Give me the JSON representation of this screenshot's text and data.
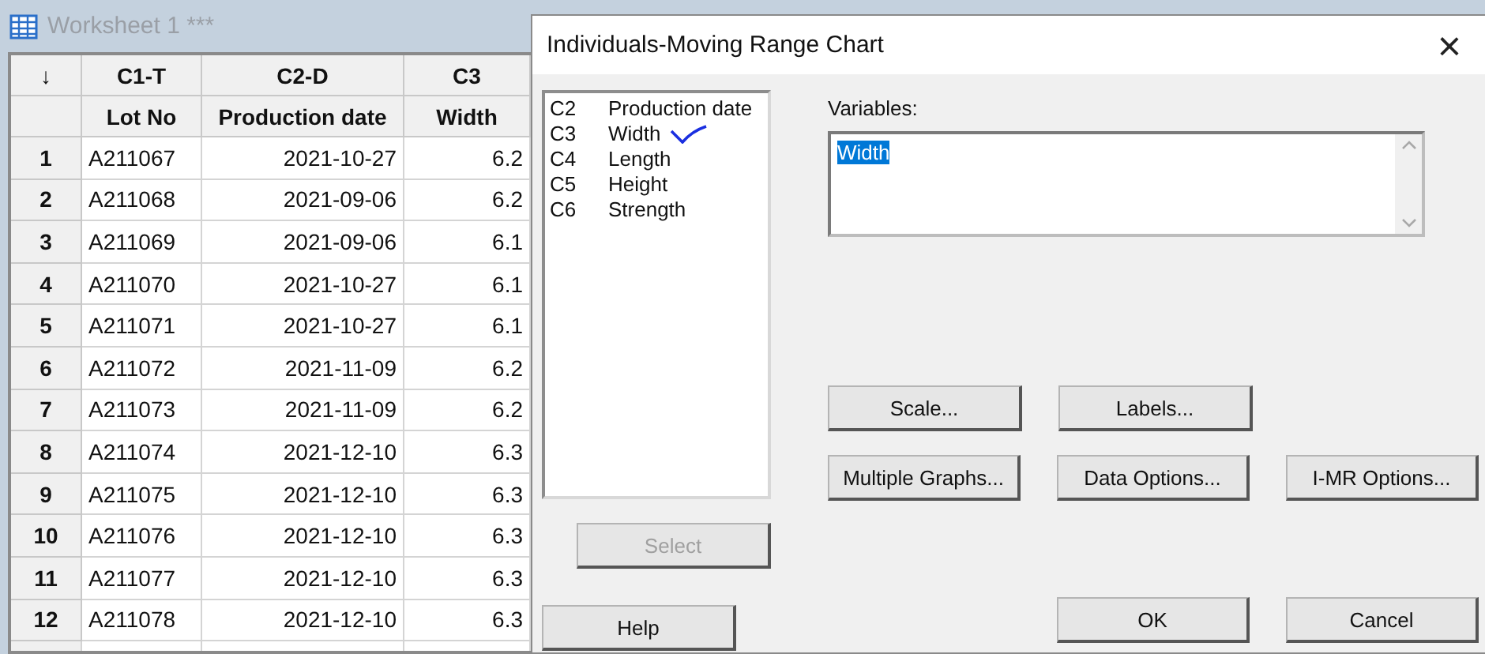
{
  "worksheet": {
    "title": "Worksheet 1 ***",
    "corner": "↓",
    "columns": [
      {
        "id": "C1-T",
        "name": "Lot No"
      },
      {
        "id": "C2-D",
        "name": "Production date"
      },
      {
        "id": "C3",
        "name": "Width"
      }
    ],
    "rows": [
      {
        "n": "1",
        "cells": [
          "A211067",
          "2021-10-27",
          "6.2"
        ]
      },
      {
        "n": "2",
        "cells": [
          "A211068",
          "2021-09-06",
          "6.2"
        ]
      },
      {
        "n": "3",
        "cells": [
          "A211069",
          "2021-09-06",
          "6.1"
        ]
      },
      {
        "n": "4",
        "cells": [
          "A211070",
          "2021-10-27",
          "6.1"
        ]
      },
      {
        "n": "5",
        "cells": [
          "A211071",
          "2021-10-27",
          "6.1"
        ]
      },
      {
        "n": "6",
        "cells": [
          "A211072",
          "2021-11-09",
          "6.2"
        ]
      },
      {
        "n": "7",
        "cells": [
          "A211073",
          "2021-11-09",
          "6.2"
        ]
      },
      {
        "n": "8",
        "cells": [
          "A211074",
          "2021-12-10",
          "6.3"
        ]
      },
      {
        "n": "9",
        "cells": [
          "A211075",
          "2021-12-10",
          "6.3"
        ]
      },
      {
        "n": "10",
        "cells": [
          "A211076",
          "2021-12-10",
          "6.3"
        ]
      },
      {
        "n": "11",
        "cells": [
          "A211077",
          "2021-12-10",
          "6.3"
        ]
      },
      {
        "n": "12",
        "cells": [
          "A211078",
          "2021-12-10",
          "6.3"
        ]
      }
    ]
  },
  "dialog": {
    "title": "Individuals-Moving Range Chart",
    "close": "×",
    "column_list": [
      {
        "id": "C2",
        "name": "Production date",
        "marked": false
      },
      {
        "id": "C3",
        "name": "Width",
        "marked": true
      },
      {
        "id": "C4",
        "name": "Length",
        "marked": false
      },
      {
        "id": "C5",
        "name": "Height",
        "marked": false
      },
      {
        "id": "C6",
        "name": "Strength",
        "marked": false
      }
    ],
    "variables": {
      "label": "Variables:",
      "value": "Width",
      "selected": true
    },
    "select_button": {
      "label": "Select",
      "disabled": true
    },
    "option_buttons": [
      [
        "Scale...",
        "Labels..."
      ],
      [
        "Multiple Graphs...",
        "Data Options...",
        "I-MR Options..."
      ]
    ],
    "help_button": "Help",
    "ok_button": "OK",
    "cancel_button": "Cancel"
  }
}
